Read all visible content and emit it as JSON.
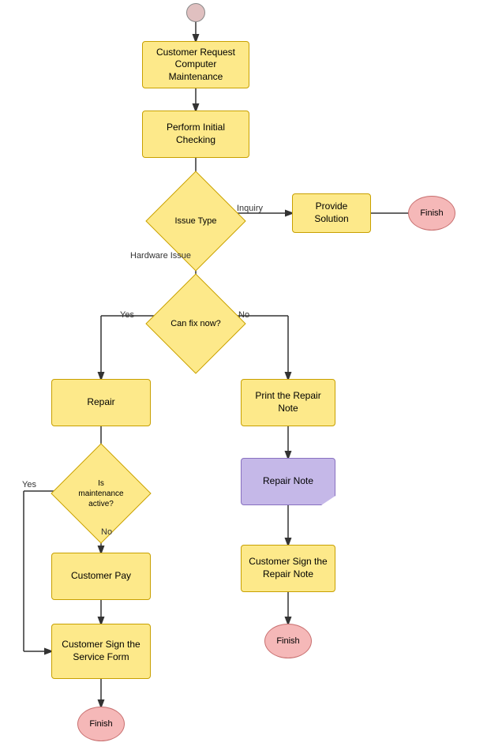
{
  "nodes": {
    "start": {
      "label": ""
    },
    "request": {
      "label": "Customer Request\nComputer Maintenance"
    },
    "initial_check": {
      "label": "Perform Initial Checking"
    },
    "issue_type": {
      "label": "Issue Type"
    },
    "provide_solution": {
      "label": "Provide Solution"
    },
    "finish1": {
      "label": "Finish"
    },
    "can_fix": {
      "label": "Can fix now?"
    },
    "repair": {
      "label": "Repair"
    },
    "print_repair": {
      "label": "Print the Repair Note"
    },
    "repair_note_doc": {
      "label": "Repair Note"
    },
    "customer_sign_repair": {
      "label": "Customer Sign the Repair Note"
    },
    "finish3": {
      "label": "Finish"
    },
    "is_maintenance": {
      "label": "Is\nmaintenance\nactive?"
    },
    "customer_pay": {
      "label": "Customer Pay"
    },
    "customer_sign_service": {
      "label": "Customer Sign the Service Form"
    },
    "finish2": {
      "label": "Finish"
    }
  },
  "labels": {
    "inquiry": "Inquiry",
    "hardware": "Hardware Issue",
    "yes_fix": "Yes",
    "no_fix": "No",
    "yes_maint": "Yes",
    "no_maint": "No"
  },
  "colors": {
    "rect_bg": "#fde98a",
    "rect_border": "#c8a000",
    "diamond_bg": "#fde98a",
    "oval_bg": "#f5b8b8",
    "oval_border": "#c87070",
    "doc_bg": "#c5b8e8",
    "doc_border": "#8870c0",
    "start_bg": "#e0b0b0",
    "arrow": "#333"
  }
}
